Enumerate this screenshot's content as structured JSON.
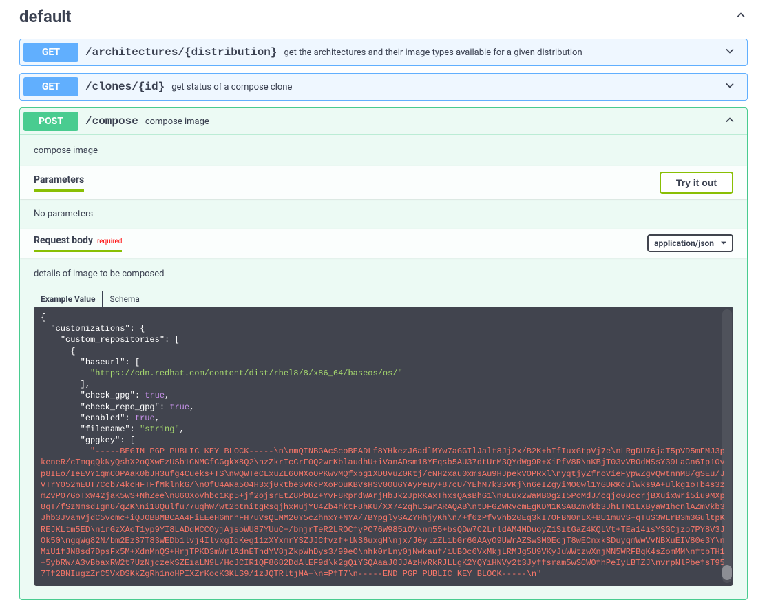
{
  "section": {
    "title": "default"
  },
  "ops": [
    {
      "method": "GET",
      "path": "/architectures/{distribution}",
      "desc": "get the architectures and their image types available for a given distribution"
    },
    {
      "method": "GET",
      "path": "/clones/{id}",
      "desc": "get status of a compose clone"
    },
    {
      "method": "POST",
      "path": "/compose",
      "desc": "compose image"
    }
  ],
  "expanded": {
    "desc": "compose image",
    "params_title": "Parameters",
    "try_label": "Try it out",
    "no_params": "No parameters",
    "reqbody_title": "Request body",
    "required": "required",
    "content_type": "application/json",
    "body_desc": "details of image to be composed",
    "tabs": {
      "example": "Example Value",
      "schema": "Schema"
    }
  },
  "code": {
    "customizations": "customizations",
    "custom_repositories": "custom_repositories",
    "baseurl": "baseurl",
    "baseurl_val": "https://cdn.redhat.com/content/dist/rhel8/8/x86_64/baseos/os/",
    "check_gpg": "check_gpg",
    "check_repo_gpg": "check_repo_gpg",
    "enabled": "enabled",
    "filename": "filename",
    "filename_val": "string",
    "gpgkey": "gpgkey",
    "pgp_block": "-----BEGIN PGP PUBLIC KEY BLOCK-----\\n\\nmQINBGAcScoBEADLf8YHkezJ6adlMYw7aGGIlJalt8Jj2x/B2K+hIfIuxGtpVj7e\\nLRgDU76jaT5pVD5mFMJ3pkeneR/cTmqqQkNyQshX2oQXwEzUSb1CNMCfCGgkX8Q2\\nzZkrIcCrF0Q2wrKblaudhU+iVanADsm18YEqsb5AU37dtUrM3QYdWg9R+XiPfV8R\\nKBjT03vVBOdMSsY39LaCn6Ip1Ovp8IEo/IeEVY1qmCOPAaK0bJH3ufg4Cueks+TS\\nwQWTeCLxuZL6OMXoOPKwvMQfxbg1XD8vuZ0Ktj/cNH2xau0xmsAu9HJpekVOPRxl\\nyqtjyZfroVieFypwZgvQwtnnM8/gSEu/JVTrY052mEUT7Ccb74kcHFTFfMklnkG/\\n0fU4ARa504H3xj0ktbe3vKcPXoPOuKBVsHSv00UGYAyPeuy+87cU/YEhM7k3SVKj\\n6eIZgyiMO0wl1YGDRKculwks9A+ulkg1oTb4s3zmZvP07GoTxW42jaK5WS+NhZee\\n860XoVhbc1Kp5+jf2ojsrEtZ8PbUZ+YvF8RprdWArjHbJk2JpRKAxThxsQAsBhG1\\n0Lux2WaMB0g2I5PcMdJ/cqjo08ccrjBXuixWri5iu9MXp8qT/fSzNmsdIgn8/qZK\\ni18Qulfu77uqhW/wt2btnitgRsqjhxMujYU4Zb4hktF8hKU/XX742qhLSWrARAQAB\\ntDFGZWRvcmEgKDM1KSA8ZmVkb3JhLTM1LXByaW1hcnlAZmVkb3Jhb3JvamVjdC5vcmc+iQJOBBMBCAA4FiEEeH6mrhFH7uVsQLMM20Y5cZhnxY+NYA/7BYpglySAZYHhjyKh\\n/+f6zPfvVhb20Eq3kI7OFBN0nLX+BU1muvS+qTuS3WLrB3m3GultpKREJKLtm5ED\\n1rGzXAoT1yp9YI8LADdMCCOyjAjsoWU87YUuC+/bnjrTeR2LROCfyPC76W985iOV\\nm55+bsQDw7C2LrldAM4MDuoyZ1SitGaZ4KQLVt+TEa14isYSGCjzo7PY8V3JOk50\\ngqWg82N/bm2EzS7T83WEDb1lvj4IlvxgIqKeg11zXYxmrYSZJJCfvzf+lNS6uxgH\\njx/J0ylzZLibGr6GAAyO9UWrAZSwSM0EcjT8wECnxkSDuyqmWwVvNBXuEIV80e3Y\\nMiU1fJN8sd7DpsFx5M+XdnMnQS+HrjTPKD3mWrlAdnEThdYV8jZkpWhDys3/99eO\\nhk0rLny0jNwkauf/iUBOc6VxMkjLRMJg5U9VKyJuWWtzwXnjMN5WRFBqK4sZomMM\\nftbTH1+5ybRW/A3vBbaxRW2t7UzNjczekSZEiaLN9L/HcJCIR1QF8682DdAlEF9d\\k2gQiYSQAaaJ0JJAzHvRkRJLLgK2YQYiHNVy2t3Jyffsram5wSCWOfhPeIyLBTZJ\\nvrpNlPbefsT957Tf2BNIugzZrC5VxDSKkZgRh1noHPIXZrKocK3KLS9/1zJQTRltjMA+\\n=PfT7\\n-----END PGP PUBLIC KEY BLOCK-----\\n"
  }
}
